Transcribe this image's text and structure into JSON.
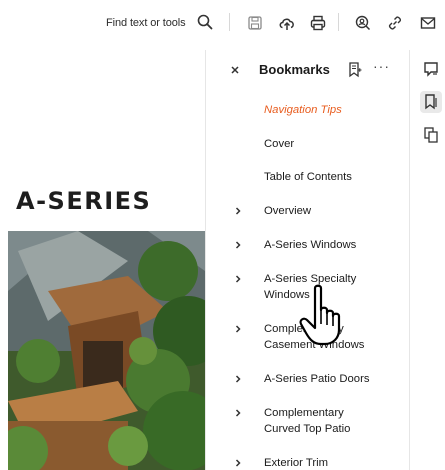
{
  "toolbar": {
    "find_placeholder": "Find text or tools",
    "icons": [
      "search-icon",
      "save-icon",
      "upload-icon",
      "print-icon",
      "search-user-icon",
      "link-icon",
      "mail-icon"
    ]
  },
  "document": {
    "heading": "A-SERIES"
  },
  "bookmarks": {
    "title": "Bookmarks",
    "more_label": "···",
    "items": [
      {
        "label": "Navigation Tips",
        "expandable": false,
        "active": true
      },
      {
        "label": "Cover",
        "expandable": false,
        "active": false
      },
      {
        "label": "Table of Contents",
        "expandable": false,
        "active": false
      },
      {
        "label": "Overview",
        "expandable": true,
        "active": false
      },
      {
        "label": "A-Series Windows",
        "expandable": true,
        "active": false
      },
      {
        "label_line1": "A-Series Specialty",
        "label_line2": "Windows",
        "expandable": true,
        "active": false
      },
      {
        "label_line1": "Complementary",
        "label_line2": "Casement Windows",
        "expandable": true,
        "active": false
      },
      {
        "label": "A-Series Patio Doors",
        "expandable": true,
        "active": false
      },
      {
        "label_line1": "Complementary",
        "label_line2": "Curved Top Patio",
        "expandable": true,
        "active": false
      },
      {
        "label": "Exterior Trim",
        "expandable": true,
        "active": false
      }
    ]
  },
  "rail": {
    "icons": [
      "comment-icon",
      "bookmark-panel-icon",
      "pages-icon"
    ],
    "selected": "bookmark-panel-icon"
  },
  "colors": {
    "active_bookmark": "#e85c1e",
    "text": "#1b1b1b",
    "divider": "#e6e6e6"
  }
}
